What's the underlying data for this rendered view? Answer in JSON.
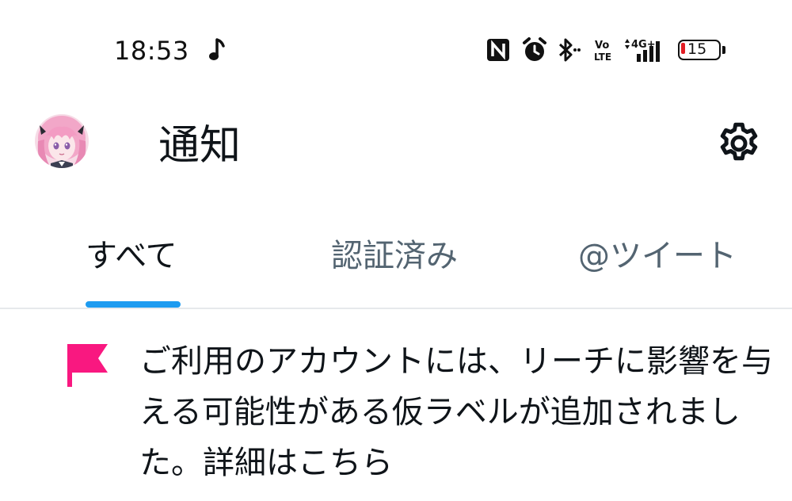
{
  "status_bar": {
    "time": "18:53",
    "icons": [
      "music-note-icon",
      "nfc-icon",
      "alarm-icon",
      "bluetooth-icon",
      "volte-icon",
      "4g-signal-icon",
      "battery-icon"
    ],
    "battery_level": "15",
    "battery_color": "#e21d24"
  },
  "header": {
    "title": "通知",
    "settings_icon": "gear-icon"
  },
  "tabs": [
    {
      "label": "すべて",
      "active": true
    },
    {
      "label": "認証済み",
      "active": false
    },
    {
      "label": "@ツイート",
      "active": false
    }
  ],
  "notification": {
    "icon": "flag-icon",
    "icon_color": "#f91880",
    "text": "ご利用のアカウントには、リーチに影響を与える可能性がある仮ラベルが追加されました。詳細はこちら"
  },
  "colors": {
    "accent": "#1d9bf0",
    "text_primary": "#0f1419",
    "text_secondary": "#536471",
    "divider": "#e6e9ec"
  }
}
